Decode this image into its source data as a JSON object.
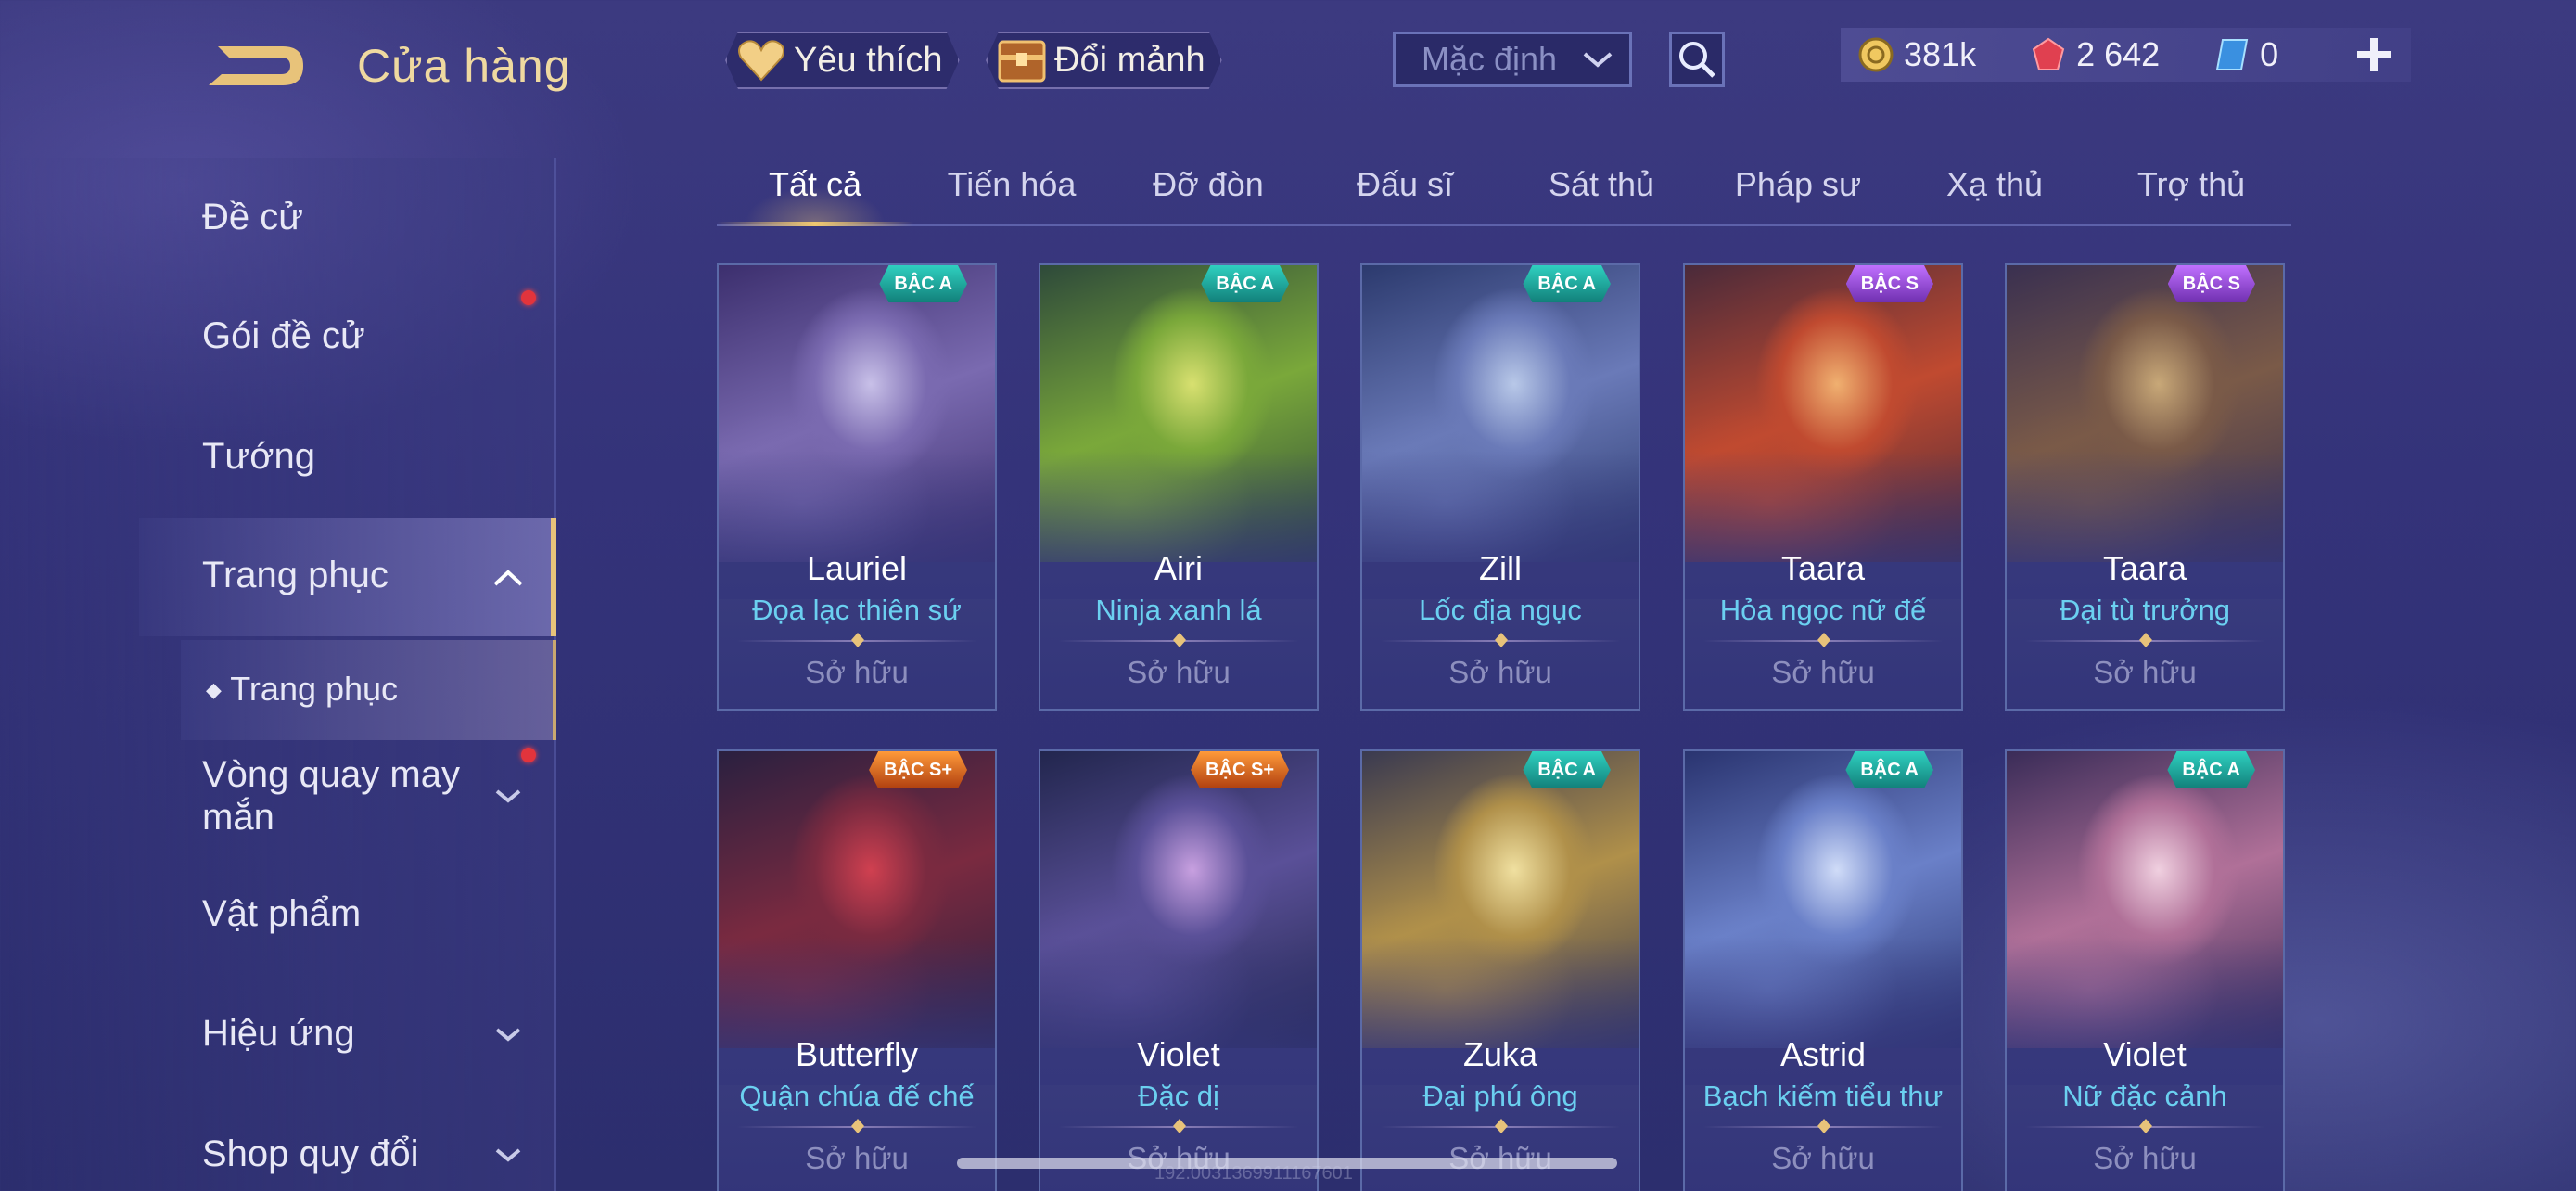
{
  "header": {
    "title": "Cửa hàng",
    "favorite_label": "Yêu thích",
    "exchange_label": "Đổi mảnh",
    "sort_label": "Mặc định",
    "currencies": [
      {
        "icon": "gold-coin-icon",
        "value": "381k"
      },
      {
        "icon": "ruby-icon",
        "value": "2 642"
      },
      {
        "icon": "voucher-icon",
        "value": "0"
      }
    ]
  },
  "sidebar": {
    "items": [
      {
        "label": "Đề cử"
      },
      {
        "label": "Gói đề cử"
      },
      {
        "label": "Tướng"
      },
      {
        "label": "Trang phục"
      },
      {
        "label": "Trang phục"
      },
      {
        "label": "Vòng quay may\nmắn"
      },
      {
        "label": "Vật phẩm"
      },
      {
        "label": "Hiệu ứng"
      },
      {
        "label": "Shop quy đổi"
      }
    ]
  },
  "tabs": [
    "Tất cả",
    "Tiến hóa",
    "Đỡ đòn",
    "Đấu sĩ",
    "Sát thủ",
    "Pháp sư",
    "Xạ thủ",
    "Trợ thủ"
  ],
  "cards": [
    {
      "badge": "BẬC A",
      "tier": "a",
      "hero": "Lauriel",
      "skin": "Đọa lạc thiên sứ",
      "status": "Sở hữu",
      "colors": [
        "#c8c0e8",
        "#7a6ab0",
        "#3c2f6e"
      ]
    },
    {
      "badge": "BẬC A",
      "tier": "a",
      "hero": "Airi",
      "skin": "Ninja xanh lá",
      "status": "Sở hữu",
      "colors": [
        "#d8e070",
        "#7aa83a",
        "#2e4a3a"
      ]
    },
    {
      "badge": "BẬC A",
      "tier": "a",
      "hero": "Zill",
      "skin": "Lốc địa ngục",
      "status": "Sở hữu",
      "colors": [
        "#b8c8e8",
        "#6a7ab8",
        "#2c3a6e"
      ]
    },
    {
      "badge": "BẬC S",
      "tier": "s",
      "hero": "Taara",
      "skin": "Hỏa ngọc nữ đế",
      "status": "Sở hữu",
      "colors": [
        "#f0b070",
        "#c04a30",
        "#4a2a3a"
      ]
    },
    {
      "badge": "BẬC S",
      "tier": "s",
      "hero": "Taara",
      "skin": "Đại tù trưởng",
      "status": "Sở hữu",
      "colors": [
        "#c8a878",
        "#7a5a48",
        "#3a3050"
      ]
    },
    {
      "badge": "BẬC S+",
      "tier": "sp",
      "hero": "Butterfly",
      "skin": "Quận chúa đế chế",
      "status": "Sở hữu",
      "colors": [
        "#d04050",
        "#7a2a40",
        "#2a2040"
      ]
    },
    {
      "badge": "BẬC S+",
      "tier": "sp",
      "hero": "Violet",
      "skin": "Đặc dị",
      "status": "Sở hữu",
      "colors": [
        "#c8a0e0",
        "#5a5098",
        "#22264e"
      ]
    },
    {
      "badge": "BẬC A",
      "tier": "a",
      "hero": "Zuka",
      "skin": "Đại phú ông",
      "status": "Sở hữu",
      "colors": [
        "#f0e0a0",
        "#b0904a",
        "#3a3a50"
      ]
    },
    {
      "badge": "BẬC A",
      "tier": "a",
      "hero": "Astrid",
      "skin": "Bạch kiếm tiểu thư",
      "status": "Sở hữu",
      "colors": [
        "#d0dcf8",
        "#6a80c8",
        "#2a3470"
      ]
    },
    {
      "badge": "BẬC A",
      "tier": "a",
      "hero": "Violet",
      "skin": "Nữ đặc cảnh",
      "status": "Sở hữu",
      "colors": [
        "#f0d0e0",
        "#b07098",
        "#3a2c58"
      ]
    }
  ],
  "watermark": "192.0031369911167601"
}
